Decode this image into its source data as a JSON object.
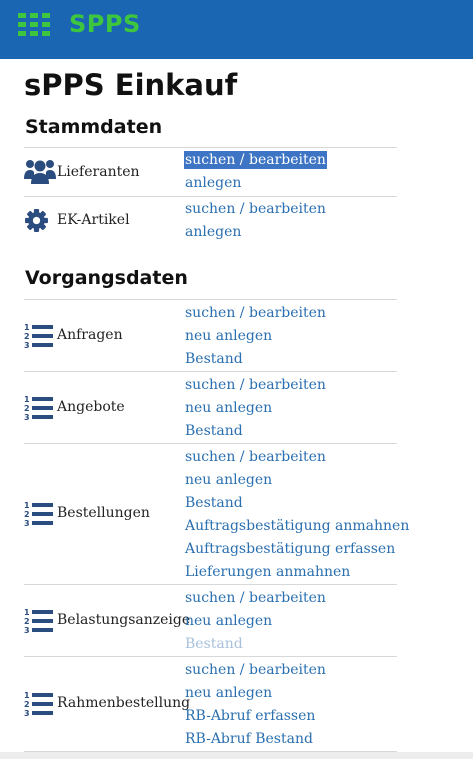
{
  "app": {
    "brand": "SPPS",
    "menu_icon": "grid-menu-icon"
  },
  "page": {
    "title": "sPPS Einkauf"
  },
  "sections": {
    "stammdaten": {
      "title": "Stammdaten",
      "rows": [
        {
          "icon": "users-icon",
          "label": "Lieferanten",
          "links": [
            "suchen / bearbeiten",
            "anlegen"
          ],
          "selected_link": 0
        },
        {
          "icon": "gear-icon",
          "label": "EK-Artikel",
          "links": [
            "suchen / bearbeiten",
            "anlegen"
          ]
        }
      ]
    },
    "vorgangsdaten": {
      "title": "Vorgangsdaten",
      "rows": [
        {
          "icon": "ordered-list-icon",
          "label": "Anfragen",
          "links": [
            "suchen / bearbeiten",
            "neu anlegen",
            "Bestand"
          ]
        },
        {
          "icon": "ordered-list-icon",
          "label": "Angebote",
          "links": [
            "suchen / bearbeiten",
            "neu anlegen",
            "Bestand"
          ]
        },
        {
          "icon": "ordered-list-icon",
          "label": "Bestellungen",
          "links": [
            "suchen / bearbeiten",
            "neu anlegen",
            "Bestand",
            "Auftragsbestätigung anmahnen",
            "Auftragsbestätigung erfassen",
            "Lieferungen anmahnen"
          ]
        },
        {
          "icon": "ordered-list-icon",
          "label": "Belastungsanzeige",
          "links": [
            "suchen / bearbeiten",
            "neu anlegen",
            "Bestand"
          ],
          "disabled_link": 2
        },
        {
          "icon": "ordered-list-icon",
          "label": "Rahmenbestellung",
          "links": [
            "suchen / bearbeiten",
            "neu anlegen",
            "RB-Abruf erfassen",
            "RB-Abruf Bestand"
          ]
        }
      ]
    }
  },
  "colors": {
    "header": "#1a66b2",
    "brand": "#3ec73e",
    "link": "#2a6fb0",
    "selection": "#3d74c4",
    "disabled_link": "#a8c1dc"
  }
}
